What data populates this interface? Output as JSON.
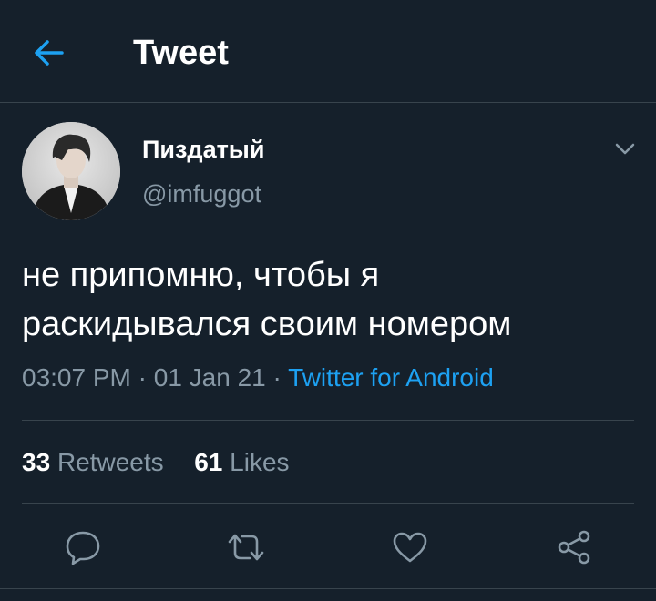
{
  "header": {
    "title": "Tweet",
    "back_icon": "arrow-left-icon"
  },
  "colors": {
    "background": "#15202b",
    "accent": "#1da1f2",
    "muted_text": "#8899a6",
    "divider": "#38444d"
  },
  "tweet": {
    "author": {
      "display_name": "Пиздатый",
      "handle": "@imfuggot",
      "avatar_icon": "avatar-photo"
    },
    "text": "не припомню, чтобы я\nраскидывался своим номером",
    "time": "03:07 PM",
    "separator": "·",
    "date": "01 Jan 21",
    "source": "Twitter for Android",
    "stats": {
      "retweets_count": "33",
      "retweets_label": "Retweets",
      "likes_count": "61",
      "likes_label": "Likes"
    },
    "actions": [
      "reply-icon",
      "retweet-icon",
      "like-icon",
      "share-icon"
    ]
  }
}
